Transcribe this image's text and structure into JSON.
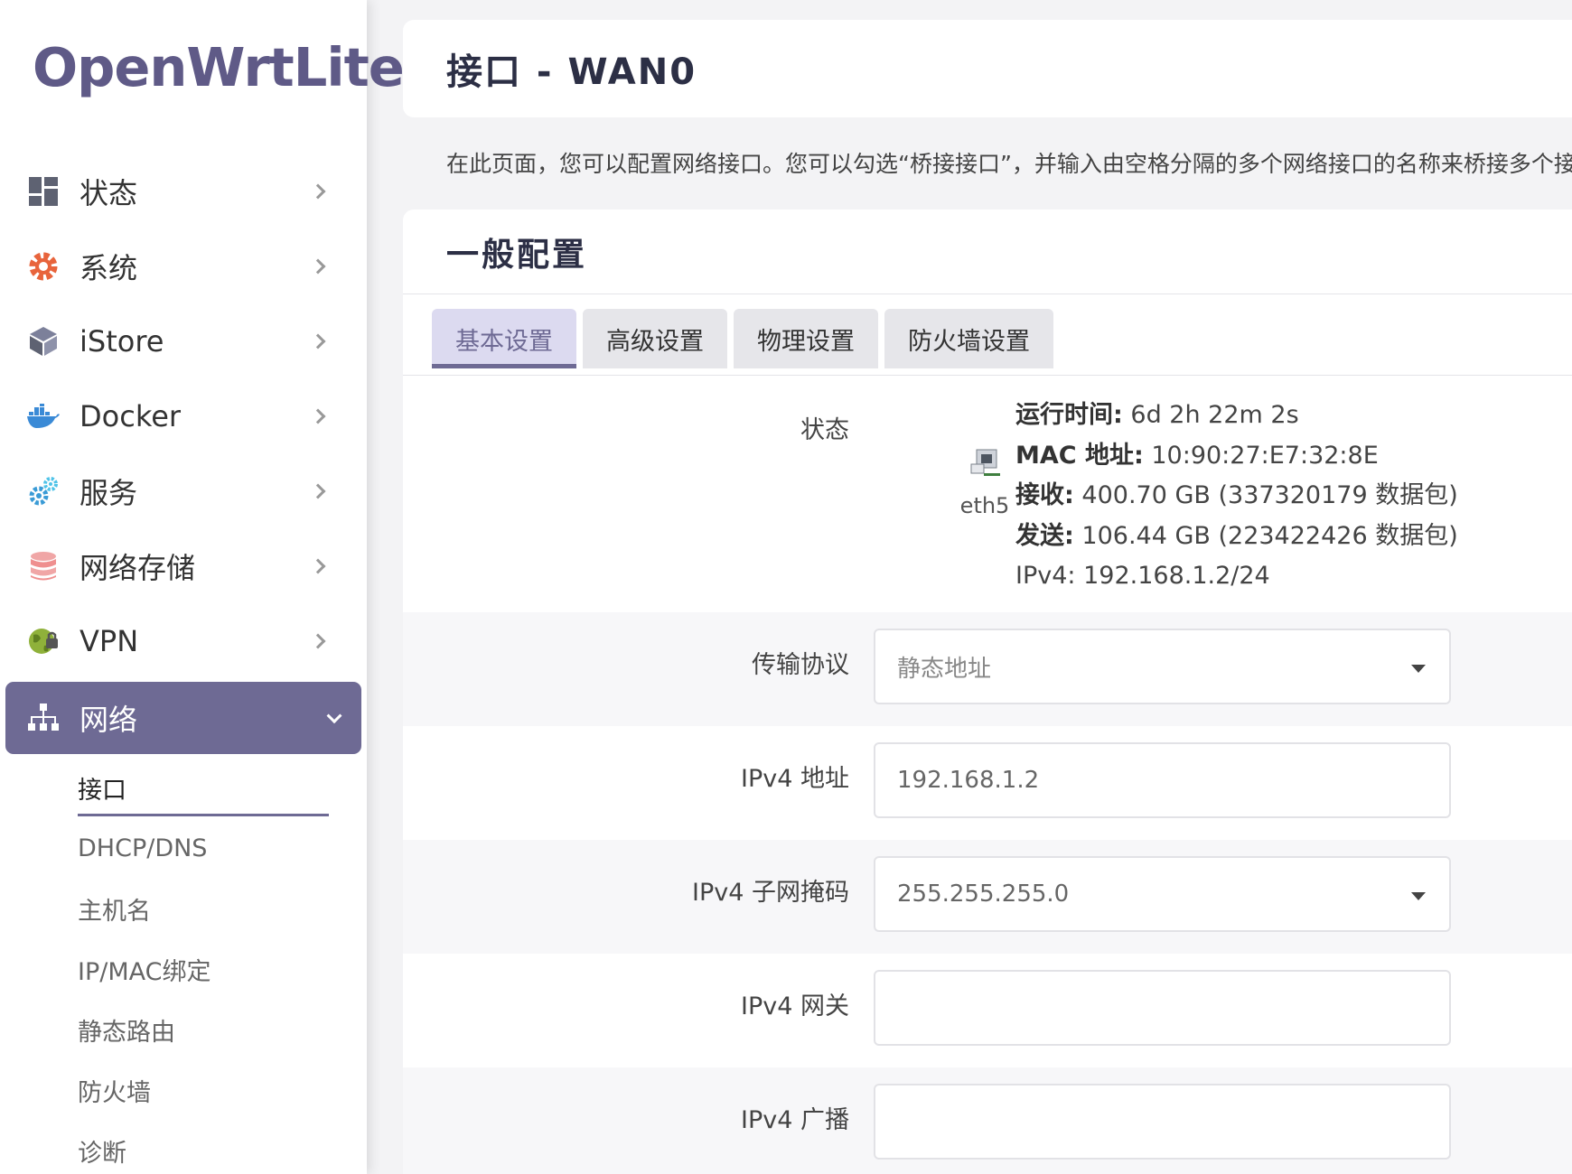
{
  "brand": "OpenWrtLite",
  "sidebar": {
    "items": [
      {
        "label": "状态",
        "icon": "dashboard-icon"
      },
      {
        "label": "系统",
        "icon": "gear-icon"
      },
      {
        "label": "iStore",
        "icon": "cube-icon"
      },
      {
        "label": "Docker",
        "icon": "docker-whale-icon"
      },
      {
        "label": "服务",
        "icon": "gears-icon"
      },
      {
        "label": "网络存储",
        "icon": "database-icon"
      },
      {
        "label": "VPN",
        "icon": "globe-lock-icon"
      },
      {
        "label": "网络",
        "icon": "network-tree-icon"
      }
    ],
    "sub_items": [
      "接口",
      "DHCP/DNS",
      "主机名",
      "IP/MAC绑定",
      "静态路由",
      "防火墙",
      "诊断"
    ],
    "active_item": "网络",
    "active_sub": "接口",
    "accent_color": "#6e6a94"
  },
  "page": {
    "title": "接口 - WAN0",
    "description": "在此页面，您可以配置网络接口。您可以勾选“桥接接口”，并输入由空格分隔的多个网络接口的名称来桥接多个接口。"
  },
  "section": {
    "title": "一般配置",
    "tabs": [
      "基本设置",
      "高级设置",
      "物理设置",
      "防火墙设置"
    ],
    "active_tab": "基本设置"
  },
  "status": {
    "label": "状态",
    "interface": "eth5",
    "uptime_key": "运行时间:",
    "uptime": "6d 2h 22m 2s",
    "mac_key": "MAC 地址:",
    "mac": "10:90:27:E7:32:8E",
    "rx_key": "接收:",
    "rx": "400.70 GB (337320179 数据包)",
    "tx_key": "发送:",
    "tx": "106.44 GB (223422426 数据包)",
    "ipv4_key": "IPv4:",
    "ipv4": "192.168.1.2/24"
  },
  "form": {
    "protocol": {
      "label": "传输协议",
      "value": "静态地址"
    },
    "ipv4_addr": {
      "label": "IPv4 地址",
      "value": "192.168.1.2"
    },
    "ipv4_mask": {
      "label": "IPv4 子网掩码",
      "value": "255.255.255.0"
    },
    "ipv4_gw": {
      "label": "IPv4 网关",
      "value": ""
    },
    "ipv4_bcast": {
      "label": "IPv4 广播",
      "value": ""
    }
  }
}
